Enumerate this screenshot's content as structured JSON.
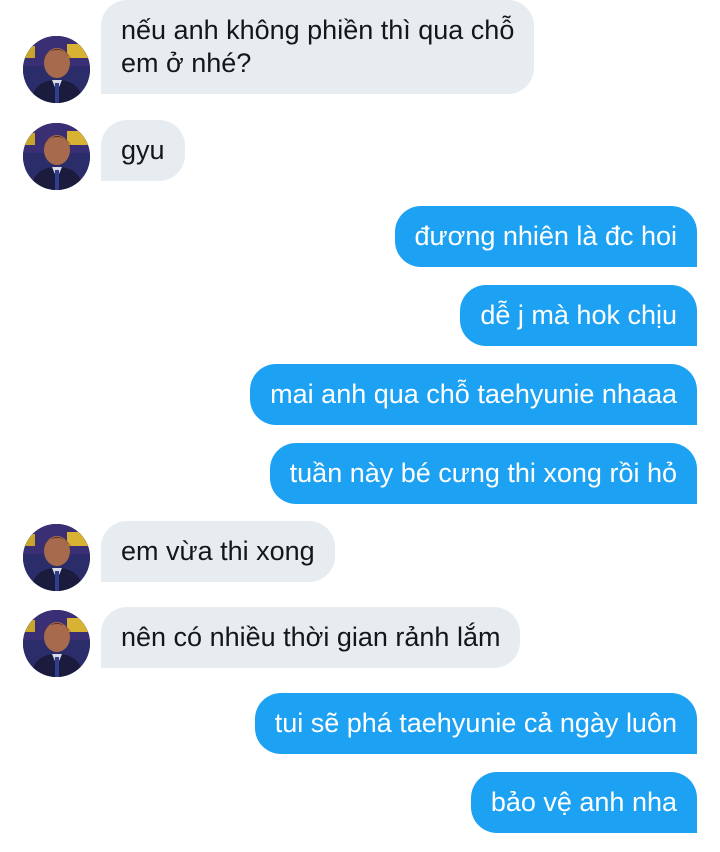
{
  "conversation": {
    "messages": [
      {
        "side": "in",
        "text": "nếu anh không phiền thì qua chỗ\nem ở nhé?",
        "avatar": "avatar-photo"
      },
      {
        "side": "in",
        "text": "gyu",
        "avatar": "avatar-photo"
      },
      {
        "side": "out",
        "text": "đương nhiên là đc hoi"
      },
      {
        "side": "out",
        "text": "dễ j mà hok chịu"
      },
      {
        "side": "out",
        "text": "mai anh qua chỗ taehyunie nhaaa"
      },
      {
        "side": "out",
        "text": "tuần này bé cưng thi xong rồi hỏ"
      },
      {
        "side": "in",
        "text": "em vừa thi xong",
        "avatar": "avatar-photo"
      },
      {
        "side": "in",
        "text": "nên có nhiều thời gian rảnh lắm",
        "avatar": "avatar-photo"
      },
      {
        "side": "out",
        "text": "tui sẽ phá taehyunie cả ngày luôn"
      },
      {
        "side": "out",
        "text": "bảo vệ anh nha"
      }
    ]
  },
  "colors": {
    "incoming_bubble": "#e6ecf0",
    "incoming_text": "#14171a",
    "outgoing_bubble": "#1da1f2",
    "outgoing_text": "#ffffff",
    "background": "#ffffff"
  }
}
